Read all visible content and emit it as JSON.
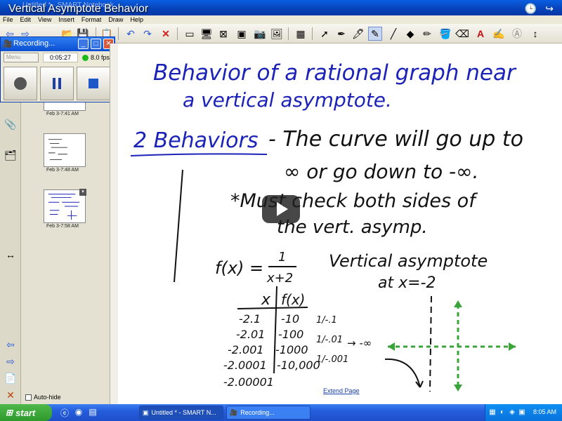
{
  "window": {
    "app_title": "Untitled * - SMART Notebook",
    "video_title": "Vertical Asymptote Behavior"
  },
  "menu": [
    "File",
    "Edit",
    "View",
    "Insert",
    "Format",
    "Draw",
    "Help"
  ],
  "recording": {
    "title": "Recording...",
    "menu_label": "Menu",
    "elapsed": "0:05:27",
    "fps": "8.0 fps"
  },
  "thumbnails": [
    {
      "label": "Feb 3-7:41 AM"
    },
    {
      "label": "Feb 3-7:48 AM"
    },
    {
      "label": "Feb 3-7:58 AM"
    }
  ],
  "sidebar": {
    "autohide_label": "Auto-hide"
  },
  "canvas": {
    "extend_page_label": "Extend Page",
    "title_line1": "Behavior of a rational graph near",
    "title_line2": "a vertical asymptote.",
    "heading": "2 Behaviors",
    "behavior_line1": "- The curve will go up to",
    "behavior_line2": "∞ or go down to -∞.",
    "note_line1": "*Must check both sides of",
    "note_line2": "the vert. asymp.",
    "function_label": "f(x) =",
    "function_numerator": "1",
    "function_denominator": "x+2",
    "asymptote_line1": "Vertical asymptote",
    "asymptote_line2": "at x=-2",
    "table_header_x": "x",
    "table_header_fx": "f(x)",
    "table_x": [
      "-2.1",
      "-2.01",
      "-2.001",
      "-2.0001",
      "-2.00001"
    ],
    "table_fx": [
      "-10",
      "-100",
      "-1000",
      "-10,000",
      ""
    ],
    "fractions": [
      "1/-.1",
      "1/-.01",
      "1/-.001"
    ],
    "arrow_note": "→ -∞"
  },
  "taskbar": {
    "start_label": "start",
    "tasks": [
      "Untitled * - SMART N...",
      "Recording..."
    ],
    "clock": "8:05 AM"
  },
  "colors": {
    "ink_blue": "#1b22b8",
    "ink_black": "#111111",
    "ink_green": "#3aa43a",
    "xp_blue": "#245ddb"
  }
}
